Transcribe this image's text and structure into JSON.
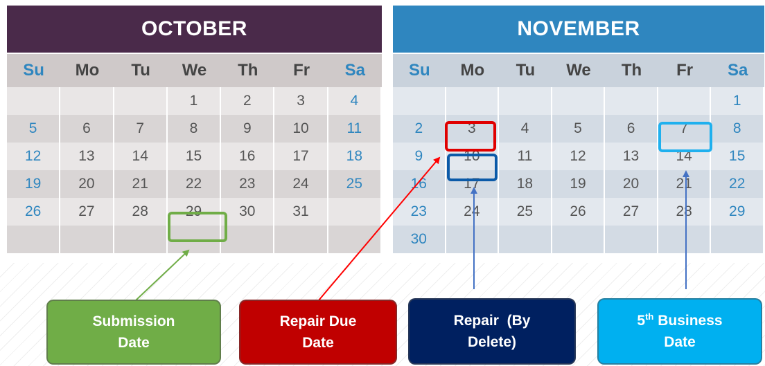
{
  "colors": {
    "october_header": "#4a2a4a",
    "november_header": "#2f86bf",
    "weekend_text": "#2f86bf",
    "submission": "#70ad47",
    "repair_due": "#c00000",
    "repair_by_delete": "#002060",
    "business_date": "#00b0f0"
  },
  "october": {
    "title": "OCTOBER",
    "days_of_week": [
      "Su",
      "Mo",
      "Tu",
      "We",
      "Th",
      "Fr",
      "Sa"
    ],
    "weeks": [
      [
        "",
        "",
        "",
        "1",
        "2",
        "3",
        "4"
      ],
      [
        "5",
        "6",
        "7",
        "8",
        "9",
        "10",
        "11"
      ],
      [
        "12",
        "13",
        "14",
        "15",
        "16",
        "17",
        "18"
      ],
      [
        "19",
        "20",
        "21",
        "22",
        "23",
        "24",
        "25"
      ],
      [
        "26",
        "27",
        "28",
        "29",
        "30",
        "31",
        ""
      ],
      [
        "",
        "",
        "",
        "",
        "",
        "",
        ""
      ]
    ]
  },
  "november": {
    "title": "NOVEMBER",
    "days_of_week": [
      "Su",
      "Mo",
      "Tu",
      "We",
      "Th",
      "Fr",
      "Sa"
    ],
    "weeks": [
      [
        "",
        "",
        "",
        "",
        "",
        "",
        "1"
      ],
      [
        "2",
        "3",
        "4",
        "5",
        "6",
        "7",
        "8"
      ],
      [
        "9",
        "10",
        "11",
        "12",
        "13",
        "14",
        "15"
      ],
      [
        "16",
        "17",
        "18",
        "19",
        "20",
        "21",
        "22"
      ],
      [
        "23",
        "24",
        "25",
        "26",
        "27",
        "28",
        "29"
      ],
      [
        "30",
        "",
        "",
        "",
        "",
        "",
        ""
      ]
    ]
  },
  "labels": {
    "submission": {
      "line1": "Submission",
      "line2": "Date"
    },
    "repair_due": {
      "line1": "Repair Due",
      "line2": "Date"
    },
    "repair_by_delete": {
      "line1": "Repair  (By",
      "line2": "Delete)"
    },
    "business": {
      "prefix": "5",
      "sup": "th",
      "suffix": " Business",
      "line2": "Date"
    }
  }
}
